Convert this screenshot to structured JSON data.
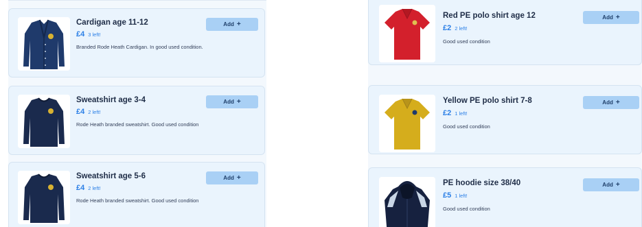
{
  "left_column": {
    "items": [
      {
        "title": "Cardigan age 11-12",
        "price": "£4",
        "stock": "3 left!",
        "description": "Branded Rode Heath Cardigan. In good used condition.",
        "button": "Add",
        "image_icon": "cardigan-icon",
        "garment_color": "#1f3a6b"
      },
      {
        "title": "Sweatshirt age 3-4",
        "price": "£4",
        "stock": "2 left!",
        "description": "Rode Heath branded sweatshirt. Good used condition",
        "button": "Add",
        "image_icon": "sweatshirt-icon",
        "garment_color": "#1a2a4d"
      },
      {
        "title": "Sweatshirt age 5-6",
        "price": "£4",
        "stock": "2 left!",
        "description": "Rode Heath branded sweatshirt. Good used condition",
        "button": "Add",
        "image_icon": "sweatshirt-icon",
        "garment_color": "#1a2a4d"
      }
    ]
  },
  "right_column": {
    "items": [
      {
        "title": "Red PE polo shirt age 12",
        "price": "£2",
        "stock": "2 left!",
        "description": "Good used condition",
        "button": "Add",
        "image_icon": "polo-shirt-icon",
        "garment_color": "#d3202c"
      },
      {
        "title": "Yellow PE polo shirt 7-8",
        "price": "£2",
        "stock": "1 left!",
        "description": "Good used condition",
        "button": "Add",
        "image_icon": "polo-shirt-icon",
        "garment_color": "#d5ad1c"
      },
      {
        "title": "PE hoodie size 38/40",
        "price": "£5",
        "stock": "1 left!",
        "description": "Good used condition",
        "button": "Add",
        "image_icon": "hoodie-icon",
        "garment_color": "#16213f"
      }
    ]
  },
  "colors": {
    "accent": "#2b7fe6",
    "button_bg": "#a9d0f5",
    "card_bg": "#eaf4fd",
    "title_text": "#1f2d47"
  }
}
